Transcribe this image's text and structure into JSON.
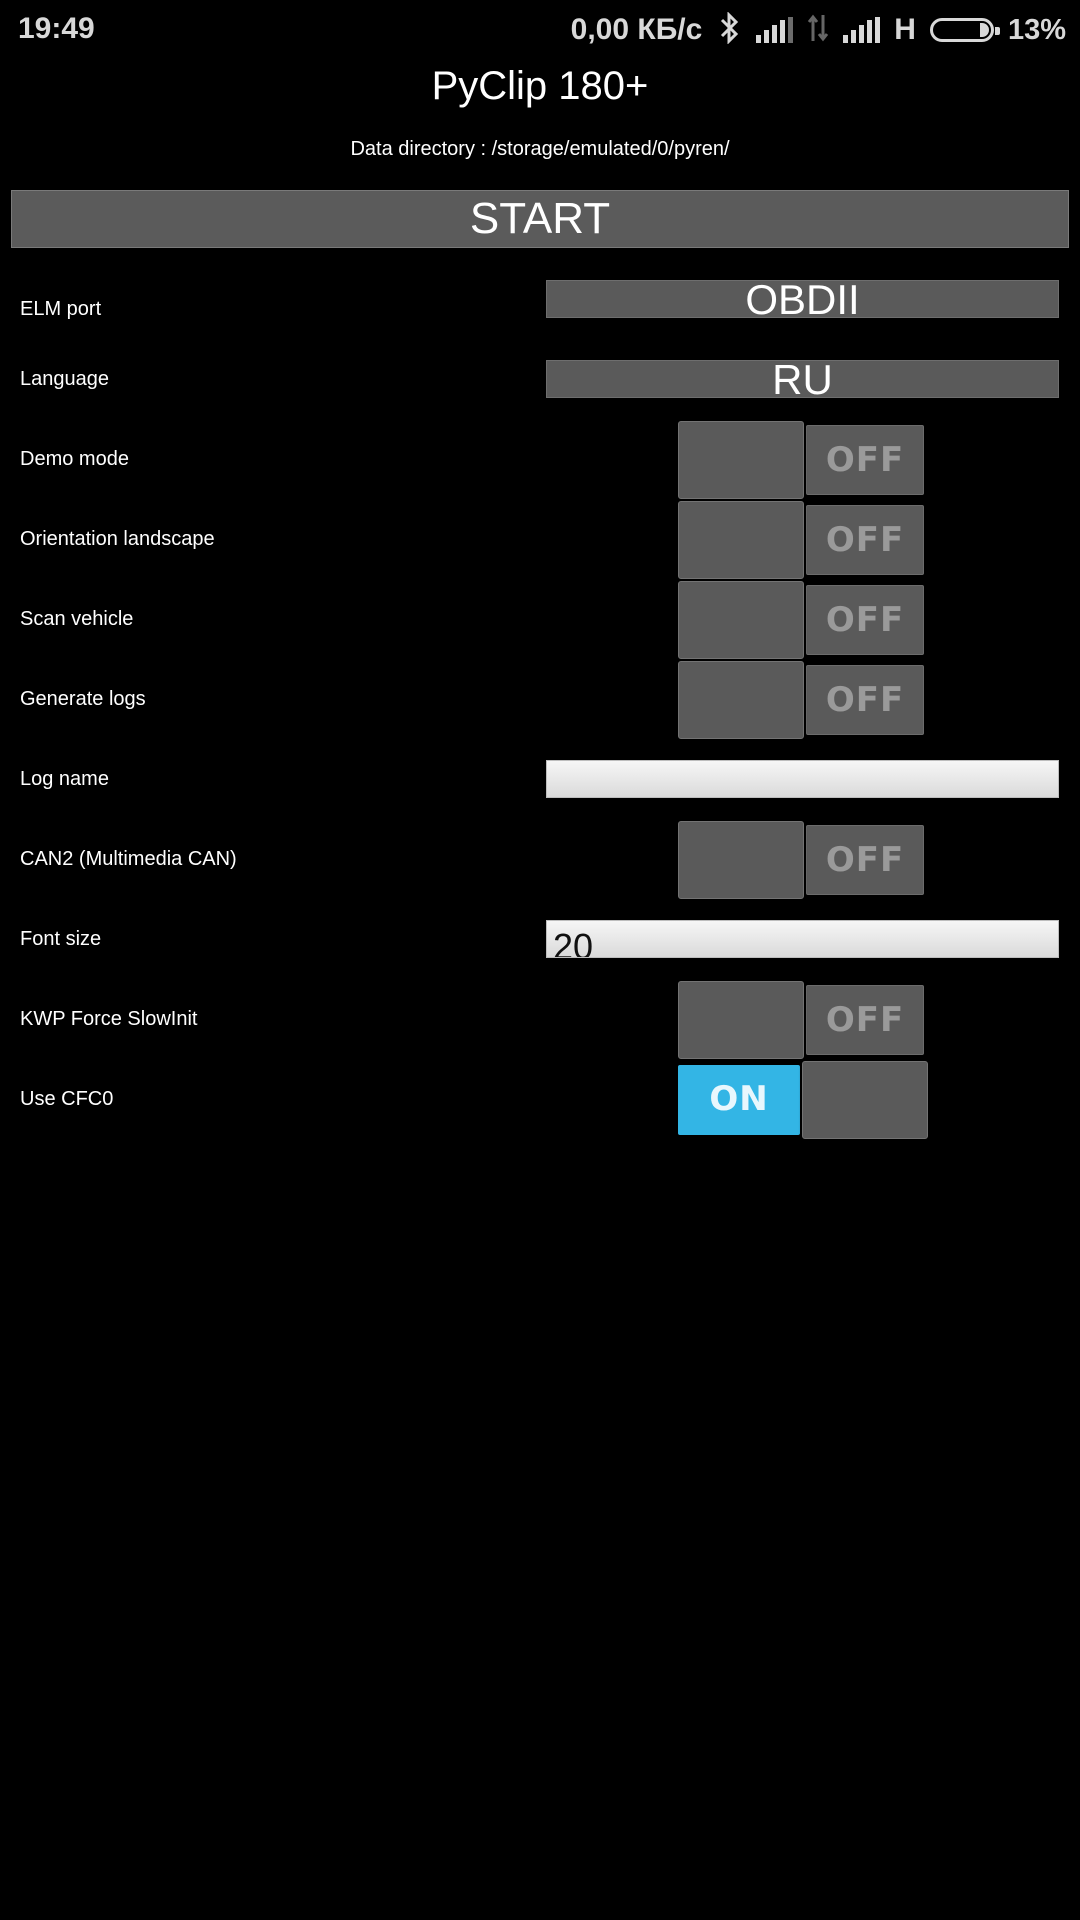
{
  "status_bar": {
    "time": "19:49",
    "speed": "0,00 КБ/с",
    "network_type": "H",
    "battery_percent": "13%",
    "icons": [
      "bluetooth-icon",
      "signal-icon",
      "data-transfer-icon",
      "signal-icon",
      "battery-icon"
    ]
  },
  "app": {
    "title": "PyClip 180+",
    "data_directory": "Data directory : /storage/emulated/0/pyren/",
    "start_label": "START"
  },
  "settings": {
    "elm_port": {
      "label": "ELM port",
      "value": "OBDII"
    },
    "language": {
      "label": "Language",
      "value": "RU"
    },
    "demo_mode": {
      "label": "Demo mode",
      "state": "OFF"
    },
    "orientation_landscape": {
      "label": "Orientation landscape",
      "state": "OFF"
    },
    "scan_vehicle": {
      "label": "Scan vehicle",
      "state": "OFF"
    },
    "generate_logs": {
      "label": "Generate logs",
      "state": "OFF"
    },
    "log_name": {
      "label": "Log name",
      "value": ""
    },
    "can2": {
      "label": "CAN2 (Multimedia CAN)",
      "state": "OFF"
    },
    "font_size": {
      "label": "Font size",
      "value": "20"
    },
    "kwp_force_slowinit": {
      "label": "KWP Force SlowInit",
      "state": "OFF"
    },
    "use_cfc0": {
      "label": "Use CFC0",
      "state": "ON"
    }
  },
  "colors": {
    "background": "#000000",
    "widget_gray": "#5a5a5a",
    "switch_on_accent": "#33b5e5"
  }
}
